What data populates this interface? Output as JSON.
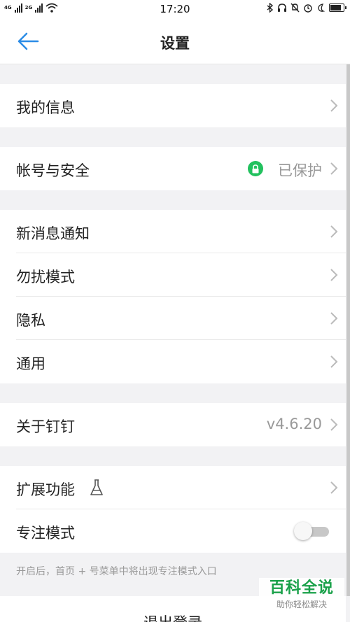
{
  "status_bar": {
    "network_1": "4G",
    "network_2": "2G",
    "time": "17:20"
  },
  "nav": {
    "title": "设置"
  },
  "rows": {
    "my_info": "我的信息",
    "account_security": "帐号与安全",
    "account_security_status": "已保护",
    "new_message_notify": "新消息通知",
    "do_not_disturb": "勿扰模式",
    "privacy": "隐私",
    "general": "通用",
    "about": "关于钉钉",
    "about_version": "v4.6.20",
    "extensions": "扩展功能",
    "focus_mode": "专注模式"
  },
  "focus_mode_enabled": false,
  "focus_hint": "开启后，首页 + 号菜单中将出现专注模式入口",
  "logout_label": "退出登录",
  "watermark": {
    "title": "百科全说",
    "subtitle": "助你轻松解决"
  },
  "colors": {
    "accent": "#2b8ce6",
    "secure_green": "#22c15e",
    "background": "#f2f2f4"
  }
}
